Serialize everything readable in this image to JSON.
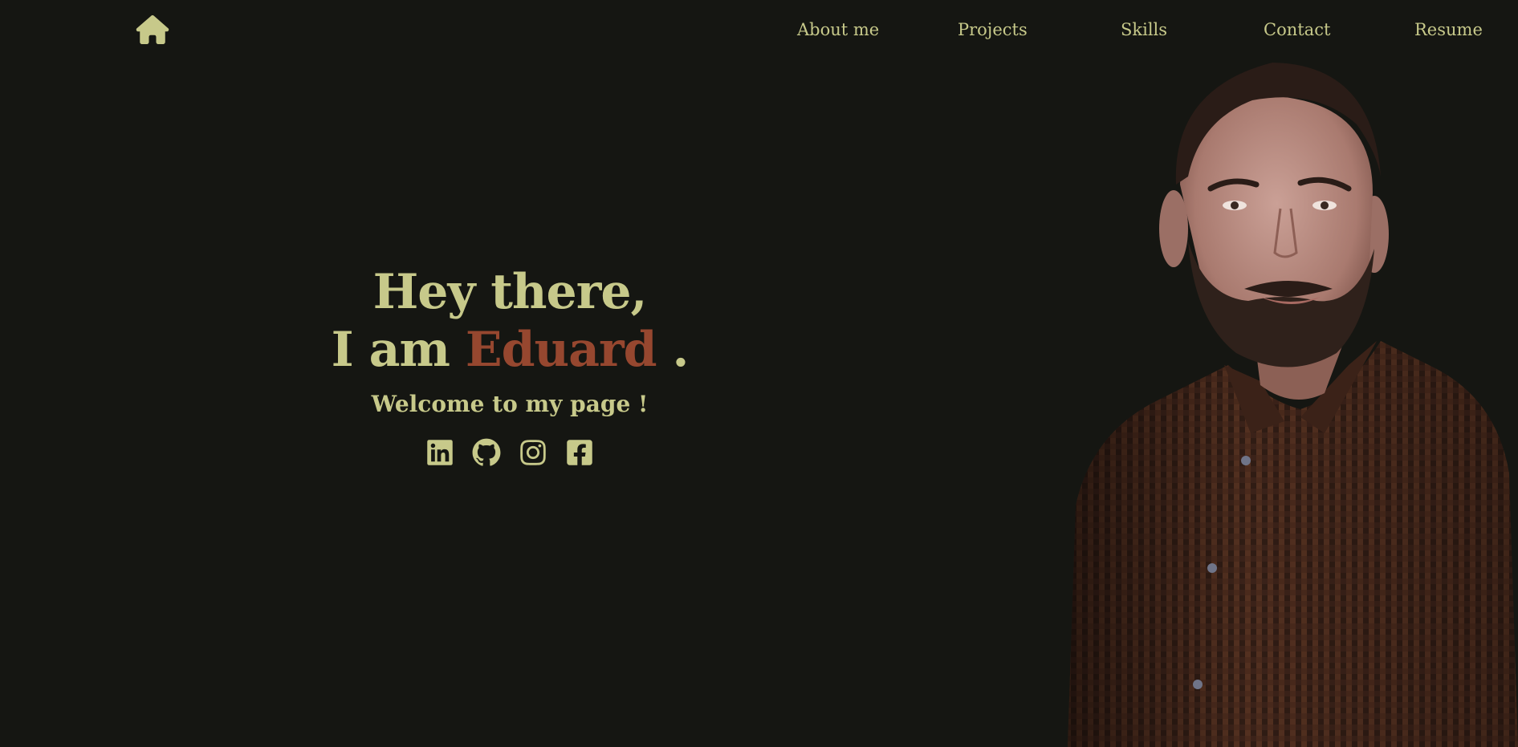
{
  "theme": {
    "background": "#151612",
    "accent": "#c7c98a",
    "highlight": "#96472f"
  },
  "nav": {
    "home_icon": "home-icon",
    "items": [
      {
        "label": "About me"
      },
      {
        "label": "Projects"
      },
      {
        "label": "Skills"
      },
      {
        "label": "Contact"
      },
      {
        "label": "Resume"
      }
    ]
  },
  "hero": {
    "greeting": "Hey there,",
    "intro_prefix": "I am ",
    "name": "Eduard",
    "intro_suffix": " .",
    "subtitle": "Welcome to my page !"
  },
  "socials": [
    {
      "icon": "linkedin-icon"
    },
    {
      "icon": "github-icon"
    },
    {
      "icon": "instagram-icon"
    },
    {
      "icon": "facebook-icon"
    }
  ],
  "portrait": {
    "icon": "portrait-photo",
    "shirt_color": "#4a2a1c"
  }
}
